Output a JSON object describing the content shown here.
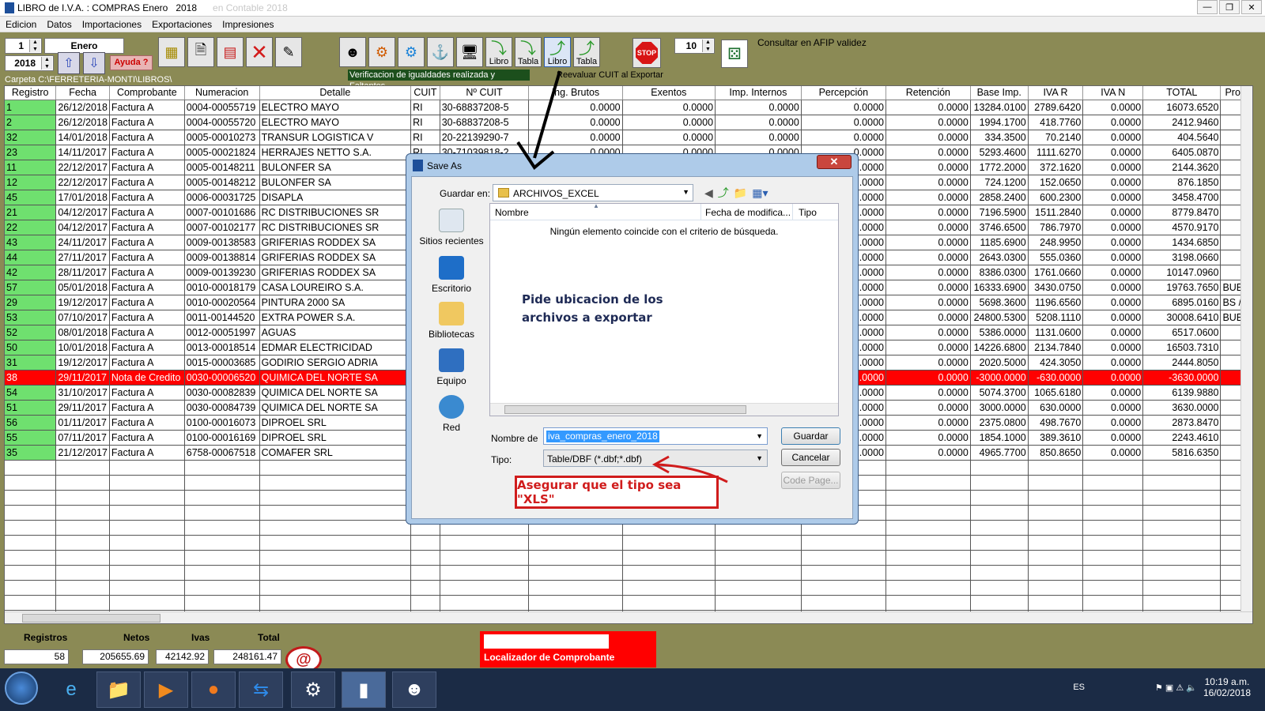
{
  "window": {
    "title": "LIBRO de I.V.A. : COMPRAS Enero",
    "year": "2018",
    "blurred_suffix": "en Contable 2018"
  },
  "menu": [
    "Edicion",
    "Datos",
    "Importaciones",
    "Exportaciones",
    "Impresiones"
  ],
  "toolbar": {
    "month_number": "1",
    "month_name": "Enero",
    "year": "2018",
    "help_label": "Ayuda ?",
    "libro_label_1": "Libro",
    "tabla_label_1": "Tabla",
    "libro_label_2": "Libro",
    "tabla_label_2": "Tabla",
    "verify_msg": "Verificacion de igualdades realizada y Faltantes",
    "reevaluar_label": "Reevaluar CUIT al Exportar",
    "folder_path": "Carpeta C:\\FERRETERIA-MONTI\\LIBROS\\",
    "stop_label": "STOP",
    "count_value": "10",
    "afip_label": "Consultar en AFIP validez"
  },
  "grid": {
    "columns": [
      "Registro",
      "Fecha",
      "Comprobante",
      "Numeracion",
      "Detalle",
      "CUIT",
      "Nº CUIT",
      "Ing. Brutos",
      "Exentos",
      "Imp. Internos",
      "Percepción",
      "Retención",
      "Base Imp.",
      "IVA R",
      "IVA N",
      "TOTAL",
      "Provi"
    ],
    "rows": [
      [
        "1",
        "26/12/2018",
        "Factura A",
        "0004-00055719",
        "ELECTRO  MAYO",
        "RI",
        "30-68837208-5",
        "0.0000",
        "0.0000",
        "0.0000",
        "0.0000",
        "0.0000",
        "13284.0100",
        "2789.6420",
        "0.0000",
        "16073.6520",
        ""
      ],
      [
        "2",
        "26/12/2018",
        "Factura A",
        "0004-00055720",
        "ELECTRO  MAYO",
        "RI",
        "30-68837208-5",
        "0.0000",
        "0.0000",
        "0.0000",
        "0.0000",
        "0.0000",
        "1994.1700",
        "418.7760",
        "0.0000",
        "2412.9460",
        ""
      ],
      [
        "32",
        "14/01/2018",
        "Factura A",
        "0005-00010273",
        "TRANSUR LOGISTICA  V",
        "RI",
        "20-22139290-7",
        "0.0000",
        "0.0000",
        "0.0000",
        "0.0000",
        "0.0000",
        "334.3500",
        "70.2140",
        "0.0000",
        "404.5640",
        ""
      ],
      [
        "23",
        "14/11/2017",
        "Factura A",
        "0005-00021824",
        "HERRAJES NETTO S.A.",
        "RI",
        "30-71039818-2",
        "0.0000",
        "0.0000",
        "0.0000",
        "0.0000",
        "0.0000",
        "5293.4600",
        "1111.6270",
        "0.0000",
        "6405.0870",
        ""
      ],
      [
        "11",
        "22/12/2017",
        "Factura A",
        "0005-00148211",
        "BULONFER SA",
        "",
        "",
        "",
        "",
        "",
        ".0000",
        "0.0000",
        "1772.2000",
        "372.1620",
        "0.0000",
        "2144.3620",
        ""
      ],
      [
        "12",
        "22/12/2017",
        "Factura A",
        "0005-00148212",
        "BULONFER SA",
        "",
        "",
        "",
        "",
        "",
        ".0000",
        "0.0000",
        "724.1200",
        "152.0650",
        "0.0000",
        "876.1850",
        ""
      ],
      [
        "45",
        "17/01/2018",
        "Factura A",
        "0006-00031725",
        "DISAPLA",
        "",
        "",
        "",
        "",
        "",
        ".0000",
        "0.0000",
        "2858.2400",
        "600.2300",
        "0.0000",
        "3458.4700",
        ""
      ],
      [
        "21",
        "04/12/2017",
        "Factura A",
        "0007-00101686",
        "RC DISTRIBUCIONES SR",
        "",
        "",
        "",
        "",
        "",
        ".0000",
        "0.0000",
        "7196.5900",
        "1511.2840",
        "0.0000",
        "8779.8470",
        ""
      ],
      [
        "22",
        "04/12/2017",
        "Factura A",
        "0007-00102177",
        "RC DISTRIBUCIONES SR",
        "",
        "",
        "",
        "",
        "",
        ".0000",
        "0.0000",
        "3746.6500",
        "786.7970",
        "0.0000",
        "4570.9170",
        ""
      ],
      [
        "43",
        "24/11/2017",
        "Factura A",
        "0009-00138583",
        "GRIFERIAS RODDEX SA",
        "",
        "",
        "",
        "",
        "",
        ".0000",
        "0.0000",
        "1185.6900",
        "248.9950",
        "0.0000",
        "1434.6850",
        ""
      ],
      [
        "44",
        "27/11/2017",
        "Factura A",
        "0009-00138814",
        "GRIFERIAS RODDEX SA",
        "",
        "",
        "",
        "",
        "",
        ".0000",
        "0.0000",
        "2643.0300",
        "555.0360",
        "0.0000",
        "3198.0660",
        ""
      ],
      [
        "42",
        "28/11/2017",
        "Factura A",
        "0009-00139230",
        "GRIFERIAS RODDEX SA",
        "",
        "",
        "",
        "",
        "",
        ".0000",
        "0.0000",
        "8386.0300",
        "1761.0660",
        "0.0000",
        "10147.0960",
        ""
      ],
      [
        "57",
        "05/01/2018",
        "Factura A",
        "0010-00018179",
        "CASA LOUREIRO S.A.",
        "",
        "",
        "",
        "",
        "",
        ".0000",
        "0.0000",
        "16333.6900",
        "3430.0750",
        "0.0000",
        "19763.7650",
        "BUE"
      ],
      [
        "29",
        "19/12/2017",
        "Factura A",
        "0010-00020564",
        "PINTURA 2000 SA",
        "",
        "",
        "",
        "",
        "",
        ".0000",
        "0.0000",
        "5698.3600",
        "1196.6560",
        "0.0000",
        "6895.0160",
        "BS /"
      ],
      [
        "53",
        "07/10/2017",
        "Factura A",
        "0011-00144520",
        "EXTRA POWER S.A.",
        "",
        "",
        "",
        "",
        "",
        ".0000",
        "0.0000",
        "24800.5300",
        "5208.1110",
        "0.0000",
        "30008.6410",
        "BUE"
      ],
      [
        "52",
        "08/01/2018",
        "Factura A",
        "0012-00051997",
        "AGUAS",
        "",
        "",
        "",
        "",
        "",
        ".0000",
        "0.0000",
        "5386.0000",
        "1131.0600",
        "0.0000",
        "6517.0600",
        ""
      ],
      [
        "50",
        "10/01/2018",
        "Factura A",
        "0013-00018514",
        "EDMAR ELECTRICIDAD",
        "",
        "",
        "",
        "",
        "",
        ".0000",
        "0.0000",
        "14226.6800",
        "2134.7840",
        "0.0000",
        "16503.7310",
        ""
      ],
      [
        "31",
        "19/12/2017",
        "Factura A",
        "0015-00003685",
        "GODIRIO SERGIO ADRIA",
        "",
        "",
        "",
        "",
        "",
        ".0000",
        "0.0000",
        "2020.5000",
        "424.3050",
        "0.0000",
        "2444.8050",
        ""
      ],
      [
        "38",
        "29/11/2017",
        "Nota de Credito",
        "0030-00006520",
        "QUIMICA DEL NORTE SA",
        "",
        "",
        "",
        "",
        "",
        ".0000",
        "0.0000",
        "-3000.0000",
        "-630.0000",
        "0.0000",
        "-3630.0000",
        ""
      ],
      [
        "54",
        "31/10/2017",
        "Factura A",
        "0030-00082839",
        "QUIMICA DEL NORTE SA",
        "",
        "",
        "",
        "",
        "",
        ".0000",
        "0.0000",
        "5074.3700",
        "1065.6180",
        "0.0000",
        "6139.9880",
        ""
      ],
      [
        "51",
        "29/11/2017",
        "Factura A",
        "0030-00084739",
        "QUIMICA DEL NORTE SA",
        "",
        "",
        "",
        "",
        "",
        ".0000",
        "0.0000",
        "3000.0000",
        "630.0000",
        "0.0000",
        "3630.0000",
        ""
      ],
      [
        "56",
        "01/11/2017",
        "Factura A",
        "0100-00016073",
        "DIPROEL SRL",
        "",
        "",
        "",
        "",
        "",
        ".0000",
        "0.0000",
        "2375.0800",
        "498.7670",
        "0.0000",
        "2873.8470",
        ""
      ],
      [
        "55",
        "07/11/2017",
        "Factura A",
        "0100-00016169",
        "DIPROEL SRL",
        "",
        "",
        "",
        "",
        "",
        ".0000",
        "0.0000",
        "1854.1000",
        "389.3610",
        "0.0000",
        "2243.4610",
        ""
      ],
      [
        "35",
        "21/12/2017",
        "Factura A",
        "6758-00067518",
        "COMAFER SRL",
        "",
        "",
        "",
        "",
        "",
        ".0000",
        "0.0000",
        "4965.7700",
        "850.8650",
        "0.0000",
        "5816.6350",
        ""
      ]
    ],
    "selected_row": 18
  },
  "totals": {
    "registros_label": "Registros",
    "netos_label": "Netos",
    "ivas_label": "Ivas",
    "total_label": "Total",
    "registros": "58",
    "netos": "205655.69",
    "ivas": "42142.92",
    "total": "248161.47",
    "localizador_label": "Localizador de Comprobante"
  },
  "dialog": {
    "title": "Save As",
    "guardar_en_label": "Guardar en:",
    "folder": "ARCHIVOS_EXCEL",
    "places": [
      "Sitios recientes",
      "Escritorio",
      "Bibliotecas",
      "Equipo",
      "Red"
    ],
    "col_nombre": "Nombre",
    "col_fecha": "Fecha de modifica...",
    "col_tipo": "Tipo",
    "empty_msg": "Ningún elemento coincide con el criterio de búsqueda.",
    "nombre_label": "Nombre de",
    "filename": "iva_compras_enero_2018",
    "tipo_label": "Tipo:",
    "tipo_value": "Table/DBF (*.dbf;*.dbf)",
    "guardar_btn": "Guardar",
    "cancelar_btn": "Cancelar",
    "codepage_btn": "Code Page..."
  },
  "annotations": {
    "note1_line1": "Pide ubicacion de los",
    "note1_line2": "archivos a exportar",
    "note2": "Asegurar que el tipo sea \"XLS\""
  },
  "taskbar": {
    "lang": "ES",
    "time": "10:19 a.m.",
    "date": "16/02/2018"
  },
  "colors": {
    "background": "#8b8a55",
    "registro_green": "#6fe06f",
    "selected_red": "#ff0000",
    "annotation_red": "#d01c1c"
  }
}
